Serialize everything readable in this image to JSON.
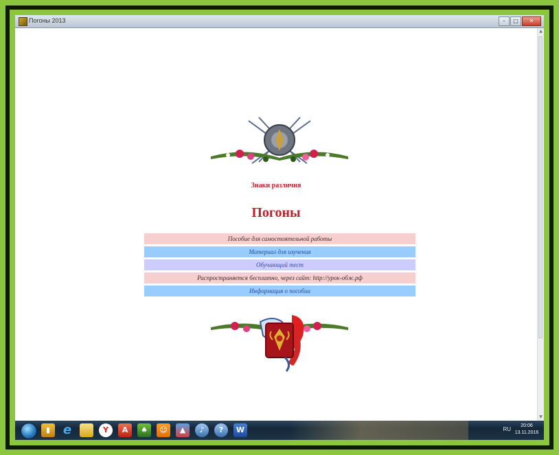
{
  "window": {
    "title": "Погоны 2013",
    "controls": {
      "minimize": "–",
      "maximize": "□",
      "close": "✕"
    }
  },
  "page": {
    "subtitle": "Знаки различия",
    "title": "Погоны",
    "menu": [
      {
        "label": "Пособие для самостоятельной работы",
        "bg": "#f8cfcf",
        "color": "#3a2a2a"
      },
      {
        "label": "Материал для изучения",
        "bg": "#99ccff",
        "color": "#2a4a9a"
      },
      {
        "label": "Обучающий тест",
        "bg": "#ccccff",
        "color": "#3a4a9a"
      },
      {
        "label": "Распространяется бесплатно, через сайт: http://урок-обж.рф",
        "bg": "#f8cfcf",
        "color": "#3a2a2a"
      },
      {
        "label": "Информация о пособии",
        "bg": "#99ccff",
        "color": "#2a4a9a"
      }
    ],
    "colors": {
      "accent": "#c0202a"
    }
  },
  "taskbar": {
    "icons": [
      "start-orb",
      "explorer-icon",
      "internet-explorer-icon",
      "folder-icon",
      "yandex-browser-icon",
      "pdf-icon",
      "green-app-icon",
      "odnoklassniki-icon",
      "paint-icon",
      "media-icon",
      "help-icon",
      "word-icon"
    ],
    "tray_lang": "RU",
    "clock_time": "20:06",
    "clock_date": "13.11.2016"
  }
}
